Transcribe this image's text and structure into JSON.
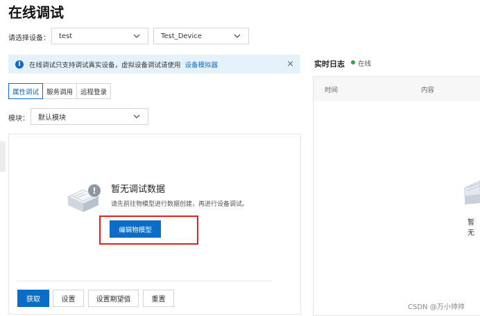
{
  "page": {
    "title": "在线调试"
  },
  "device_select": {
    "label": "请选择设备：",
    "product_value": "test",
    "device_value": "Test_Device"
  },
  "notice": {
    "text": "在线调试只支持调试真实设备，虚拟设备调试请使用",
    "link": "设备模拟器",
    "close": "×"
  },
  "tabs": [
    {
      "label": "属性调试",
      "active": true
    },
    {
      "label": "服务调用",
      "active": false
    },
    {
      "label": "远程登录",
      "active": false
    }
  ],
  "module": {
    "label": "模块：",
    "value": "默认模块"
  },
  "empty_state": {
    "title": "暂无调试数据",
    "description": "请先前往物模型进行数据创建，再进行设备调试。",
    "button": "编辑物模型",
    "badge": "!"
  },
  "actions": {
    "fetch": "获取",
    "set": "设置",
    "set_expected": "设置期望值",
    "reset": "重置"
  },
  "log": {
    "title": "实时日志",
    "status": "在线",
    "status_color": "#2da44e",
    "columns": [
      "时间",
      "内容"
    ],
    "empty_partial": "暂无"
  },
  "watermark": "CSDN @万小帅帅",
  "colors": {
    "accent": "#0b6dc7",
    "highlight": "#e02020",
    "notice_bg": "#e6f2fb"
  }
}
